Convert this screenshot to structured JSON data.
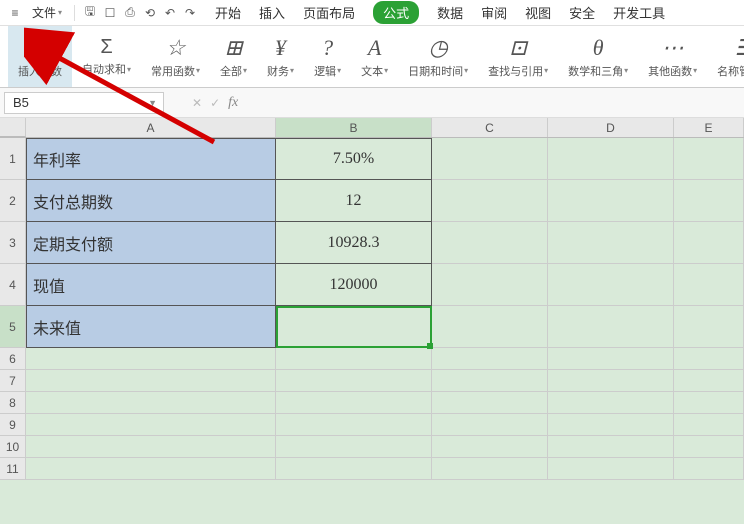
{
  "menubar": {
    "file": "文件"
  },
  "tabs": {
    "start": "开始",
    "insert": "插入",
    "layout": "页面布局",
    "formula": "公式",
    "data": "数据",
    "review": "审阅",
    "view": "视图",
    "security": "安全",
    "devtools": "开发工具"
  },
  "ribbon": {
    "insert_fn": "插入函数",
    "autosum": "自动求和",
    "common": "常用函数",
    "all": "全部",
    "finance": "财务",
    "logic": "逻辑",
    "text": "文本",
    "datetime": "日期和时间",
    "lookup": "查找与引用",
    "math": "数学和三角",
    "other": "其他函数",
    "names": "名称管理器"
  },
  "refbar": {
    "cellref": "B5",
    "fx": "fx"
  },
  "cols": {
    "A": "A",
    "B": "B",
    "C": "C",
    "D": "D",
    "E": "E"
  },
  "rows": {
    "r1": {
      "label": "年利率",
      "value": "7.50%"
    },
    "r2": {
      "label": "支付总期数",
      "value": "12"
    },
    "r3": {
      "label": "定期支付额",
      "value": "10928.3"
    },
    "r4": {
      "label": "现值",
      "value": "120000"
    },
    "r5": {
      "label": "未来值",
      "value": ""
    }
  },
  "chart_data": {
    "type": "table",
    "title": "",
    "rows": [
      {
        "label": "年利率",
        "value": "7.50%"
      },
      {
        "label": "支付总期数",
        "value": 12
      },
      {
        "label": "定期支付额",
        "value": 10928.3
      },
      {
        "label": "现值",
        "value": 120000
      },
      {
        "label": "未来值",
        "value": null
      }
    ]
  }
}
